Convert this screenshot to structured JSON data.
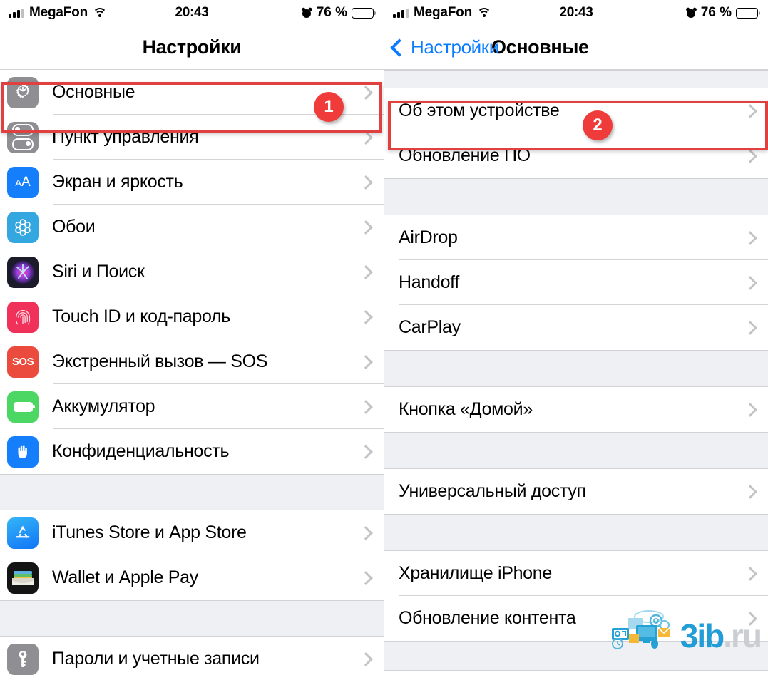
{
  "status_bar": {
    "carrier": "MegaFon",
    "time": "20:43",
    "battery_percent": "76 %",
    "icons": [
      "signal-bars",
      "wifi-icon",
      "alarm-icon",
      "battery-icon"
    ]
  },
  "left_screen": {
    "nav": {
      "title": "Настройки"
    },
    "groups": [
      {
        "rows": [
          {
            "label": "Основные",
            "icon": "gear-icon",
            "highlighted": true,
            "badge": "1"
          },
          {
            "label": "Пункт управления",
            "icon": "control-center-icon"
          },
          {
            "label": "Экран и яркость",
            "icon": "display-brightness-icon"
          },
          {
            "label": "Обои",
            "icon": "wallpaper-icon"
          },
          {
            "label": "Siri и Поиск",
            "icon": "siri-icon"
          },
          {
            "label": "Touch ID и код-пароль",
            "icon": "touch-id-icon"
          },
          {
            "label": "Экстренный вызов — SOS",
            "icon": "sos-icon"
          },
          {
            "label": "Аккумулятор",
            "icon": "battery-settings-icon"
          },
          {
            "label": "Конфиденциальность",
            "icon": "privacy-hand-icon"
          }
        ]
      },
      {
        "rows": [
          {
            "label": "iTunes Store и App Store",
            "icon": "app-store-icon"
          },
          {
            "label": "Wallet и Apple Pay",
            "icon": "wallet-icon"
          }
        ]
      },
      {
        "rows": [
          {
            "label": "Пароли и учетные записи",
            "icon": "key-icon"
          }
        ]
      }
    ]
  },
  "right_screen": {
    "nav": {
      "back_label": "Настройки",
      "title": "Основные"
    },
    "groups": [
      {
        "rows": [
          {
            "label": "Об этом устройстве",
            "highlighted": true,
            "badge": "2"
          },
          {
            "label": "Обновление ПО"
          }
        ]
      },
      {
        "rows": [
          {
            "label": "AirDrop"
          },
          {
            "label": "Handoff"
          },
          {
            "label": "CarPlay"
          }
        ]
      },
      {
        "rows": [
          {
            "label": "Кнопка «Домой»"
          }
        ]
      },
      {
        "rows": [
          {
            "label": "Универсальный доступ"
          }
        ]
      },
      {
        "rows": [
          {
            "label": "Хранилище iPhone"
          },
          {
            "label": "Обновление контента"
          }
        ]
      }
    ]
  },
  "watermark": {
    "text_primary": "3ib",
    "text_secondary": ".ru"
  },
  "colors": {
    "accent_blue": "#0a7cff",
    "highlight_red": "#e0403f",
    "badge_red": "#f03b3b",
    "group_gap": "#eef0f3",
    "separator": "#d4d4d8"
  }
}
